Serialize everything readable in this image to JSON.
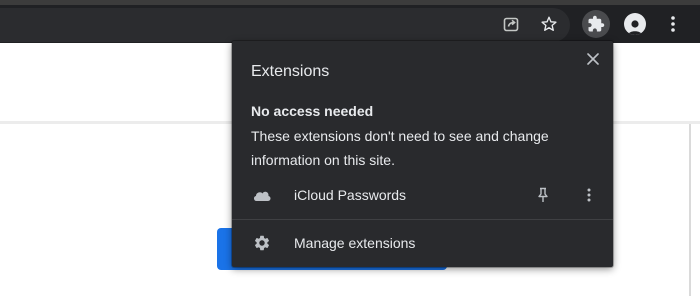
{
  "toolbar": {
    "icons": [
      "share-icon",
      "star-icon",
      "puzzle-icon",
      "account-icon",
      "more-vert-icon"
    ]
  },
  "extensions_popup": {
    "title": "Extensions",
    "section_heading": "No access needed",
    "section_description": "These extensions don't need to see and change information on this site.",
    "extensions": [
      {
        "name": "iCloud Passwords",
        "icon": "cloud-icon"
      }
    ],
    "manage_label": "Manage extensions"
  },
  "colors": {
    "toolbar_bg": "#202124",
    "popup_bg": "#292a2d",
    "popup_text": "#e8eaed",
    "accent_blue": "#1a73e8"
  }
}
